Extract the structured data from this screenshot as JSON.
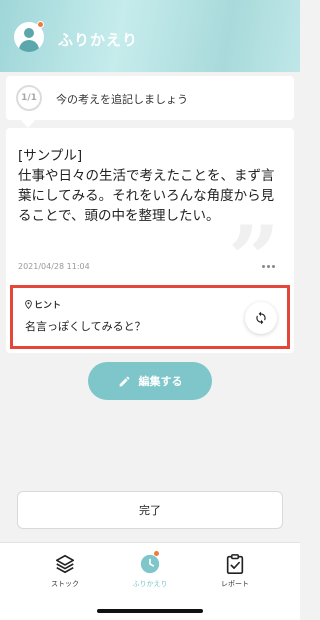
{
  "header": {
    "title": "ふりかえり"
  },
  "question": {
    "counter": "1/1",
    "text": "今の考えを追記しましょう"
  },
  "entry": {
    "text": "[サンプル]\n仕事や日々の生活で考えたことを、まず言葉にしてみる。それをいろんな角度から見ることで、頭の中を整理したい。",
    "date": "2021/04/28 11:04"
  },
  "hint": {
    "label": "ヒント",
    "text": "名言っぽくしてみると？"
  },
  "actions": {
    "edit_label": "編集する",
    "done_label": "完了"
  },
  "tabs": [
    {
      "label": "ストック",
      "icon": "layers-icon",
      "active": false
    },
    {
      "label": "ふりかえり",
      "icon": "clock-icon",
      "active": true
    },
    {
      "label": "レポート",
      "icon": "clipboard-check-icon",
      "active": false
    }
  ],
  "colors": {
    "accent": "#7fc6cb",
    "highlight": "#e4463a",
    "notification": "#f07a3d"
  }
}
